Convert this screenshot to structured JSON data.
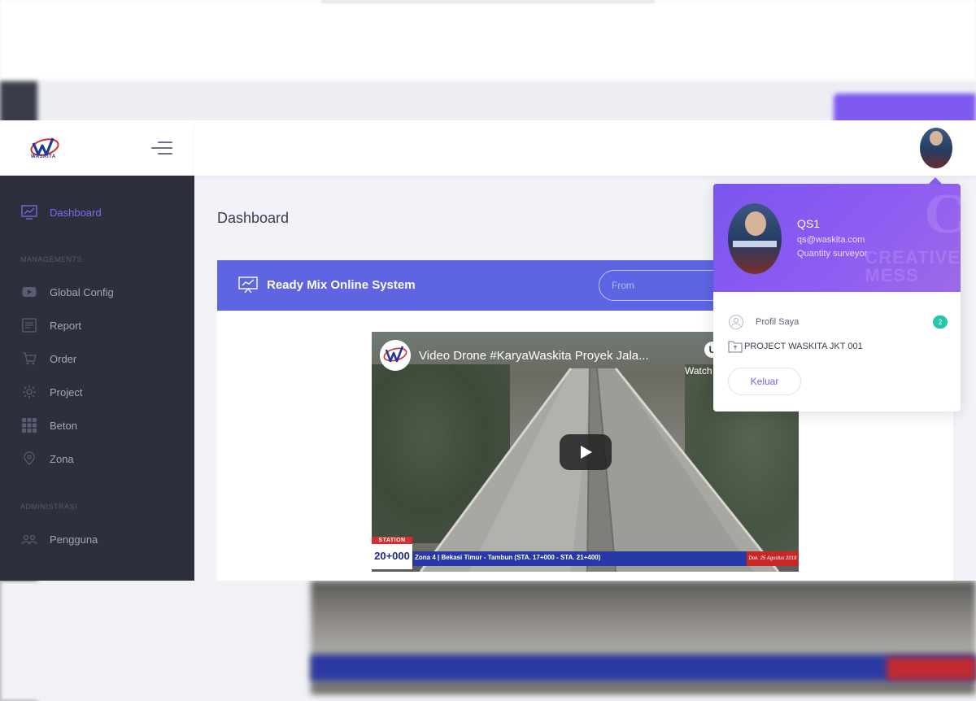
{
  "brand": {
    "logo_text": "WASKITA"
  },
  "sidebar": {
    "items_top": [
      {
        "label": "Dashboard",
        "icon": "chart-icon"
      }
    ],
    "section_managements": "MANAGEMENTS",
    "items_managements": [
      {
        "label": "Global Config",
        "icon": "youtube-icon"
      },
      {
        "label": "Report",
        "icon": "report-icon"
      },
      {
        "label": "Order",
        "icon": "cart-icon"
      },
      {
        "label": "Project",
        "icon": "project-icon"
      },
      {
        "label": "Beton",
        "icon": "grid-icon"
      },
      {
        "label": "Zona",
        "icon": "map-pin-icon"
      }
    ],
    "section_administrasi": "ADMINISTRASI",
    "items_administrasi": [
      {
        "label": "Pengguna",
        "icon": "users-icon"
      }
    ]
  },
  "main": {
    "page_title": "Dashboard",
    "card": {
      "title": "Ready Mix Online System",
      "from_placeholder": "From"
    },
    "video": {
      "title": "Video Drone #KaryaWaskita Proyek Jala...",
      "watch_label": "Watch",
      "station_label": "STATION",
      "station_value": "20+000",
      "banner_text": "Zona 4 | Bekasi Timur - Tambun (STA. 17+000 - STA. 21+400)",
      "date_text": "Dok. 25 Agustus 2019"
    }
  },
  "profile_dropdown": {
    "name": "QS1",
    "email": "qs@waskita.com",
    "role": "Quantity surveyor",
    "profile_link": "Profil Saya",
    "profile_badge": "2",
    "project_link": "PROJECT WASKITA JKT 001",
    "logout_label": "Keluar",
    "decor_letter": "C",
    "decor_words": [
      "CREATIVE",
      "MESS"
    ]
  },
  "colors": {
    "accent": "#5d65e2",
    "sidebar_bg": "#2d2f3d",
    "active_nav": "#7c6cf0",
    "dropdown_header": "#8b5ef5",
    "badge": "#26c6a8"
  }
}
